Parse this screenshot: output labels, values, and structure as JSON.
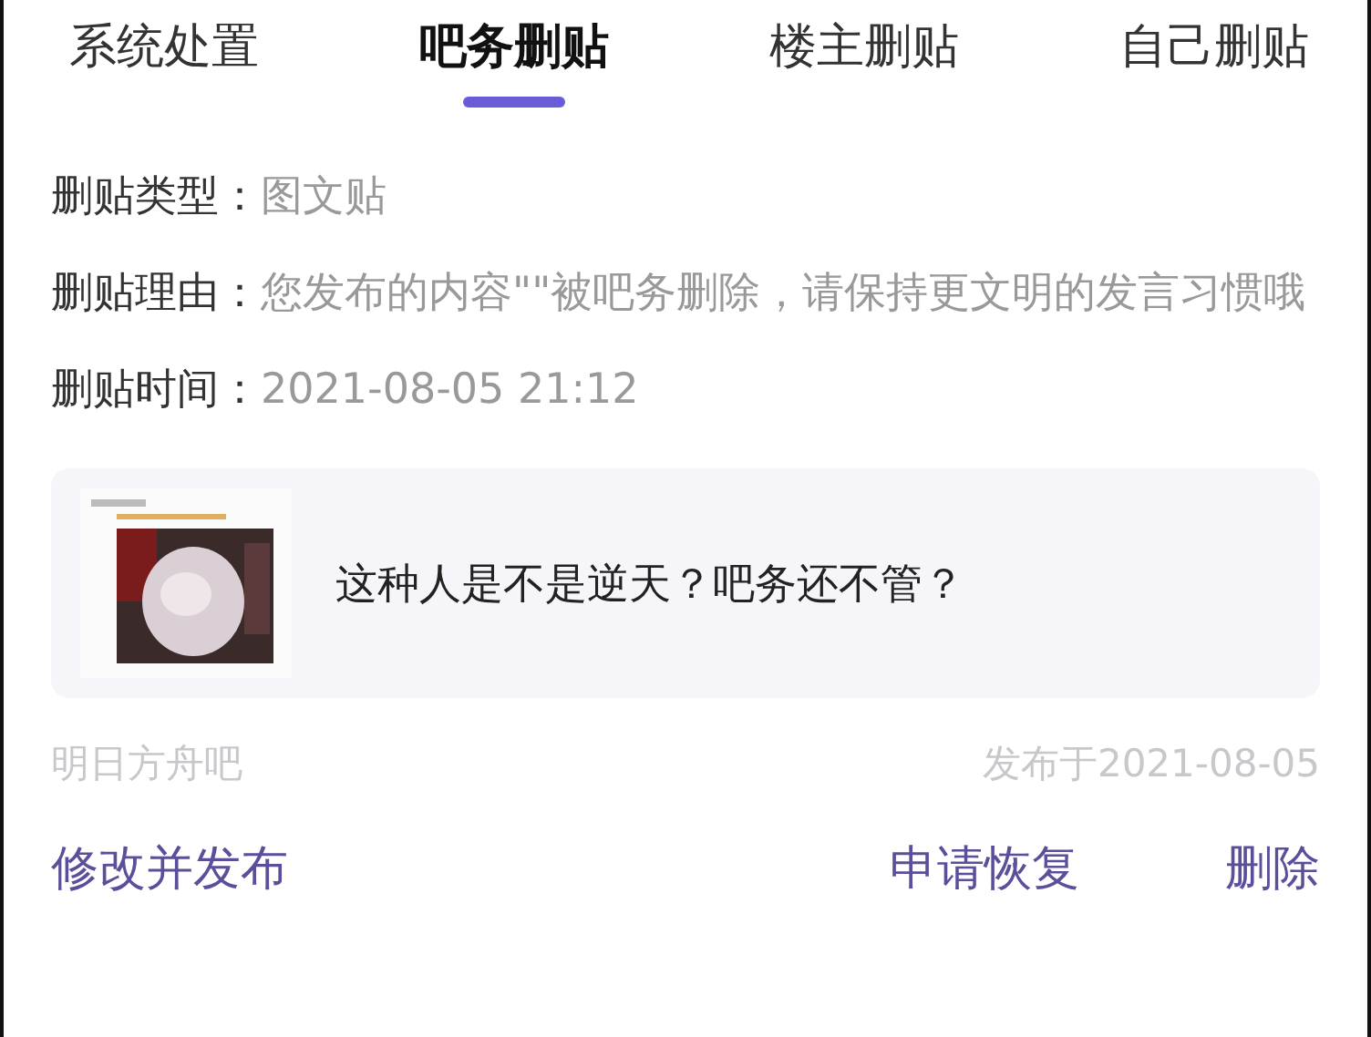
{
  "tabs": [
    {
      "label": "系统处置",
      "selected": false
    },
    {
      "label": "吧务删贴",
      "selected": true
    },
    {
      "label": "楼主删贴",
      "selected": false
    },
    {
      "label": "自己删贴",
      "selected": false
    }
  ],
  "details": [
    {
      "label": "删贴类型：",
      "value": "图文贴"
    },
    {
      "label": "删贴理由：",
      "value": "您发布的内容\"\"被吧务删除，请保持更文明的发言习惯哦"
    },
    {
      "label": "删贴时间：",
      "value": "2021-08-05 21:12"
    }
  ],
  "post": {
    "title": "这种人是不是逆天？吧务还不管？"
  },
  "forum": "明日方舟吧",
  "posted": "发布于2021-08-05",
  "actions": [
    "修改并发布",
    "申请恢复",
    "删除"
  ]
}
